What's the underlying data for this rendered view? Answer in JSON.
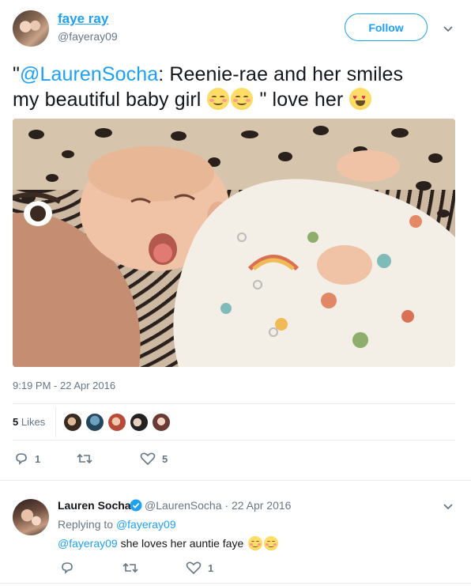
{
  "tweet": {
    "author": {
      "display_name": "faye ray",
      "handle": "@fayeray09"
    },
    "follow_label": "Follow",
    "text": {
      "quote_open": "\"",
      "mention": "@LaurenSocha",
      "body_line1": ": Reenie-rae and her smiles",
      "body_line2": "my beautiful baby girl ",
      "body_after_emojis": " \" love her "
    },
    "timestamp": "9:19 PM - 22 Apr 2016",
    "likes": {
      "count": "5",
      "label": "Likes"
    },
    "actions": {
      "reply_count": "1",
      "retweet_count": "",
      "like_count": "5"
    },
    "emojis": [
      "smiling-face-with-smiling-eyes",
      "smiling-face-with-smiling-eyes",
      "smiling-face-with-heart-eyes"
    ]
  },
  "reply": {
    "author": {
      "display_name": "Lauren Socha",
      "verified": true,
      "meta": "@LaurenSocha · 22 Apr 2016"
    },
    "replying_to_label": "Replying to",
    "replying_to_handle": "@fayeray09",
    "text": {
      "mention": "@fayeray09",
      "body": " she loves her auntie faye "
    },
    "emojis": [
      "smiling-face",
      "smiling-face"
    ],
    "actions": {
      "reply_count": "",
      "retweet_count": "",
      "like_count": "1"
    }
  },
  "colors": {
    "accent": "#1da1f2",
    "secondary_text": "#657786",
    "primary_text": "#14171a",
    "divider": "#e6ecf0"
  }
}
